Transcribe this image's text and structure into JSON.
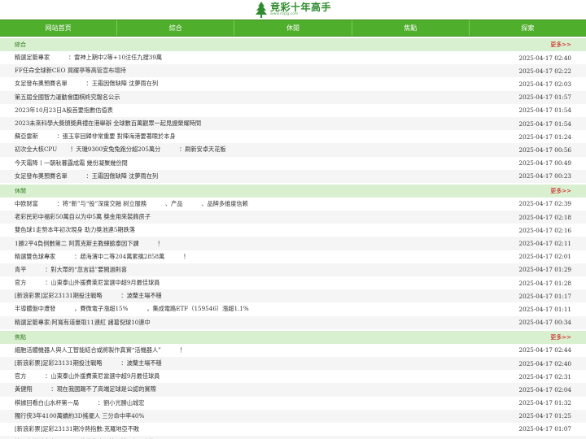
{
  "site": {
    "title": "竞彩十年高手",
    "url": "www.rbjzg.com"
  },
  "nav": [
    "网站首页",
    "綜合",
    "休閒",
    "焦點",
    "探索"
  ],
  "sections": [
    {
      "title": "綜合",
      "more": "更多>>",
      "items": [
        {
          "title": "精選足籃專家          ：雷神上期中2等+10注任九搜39萬",
          "date": "2025-04-17 02:40"
        },
        {
          "title": "FF任命全球新CEO 買躍亭等高管宣布增持",
          "date": "2025-04-17 02:22"
        },
        {
          "title": "女足發布奧預賽名單          ：王霜因傷缺陣 沈夢雨在列",
          "date": "2025-04-17 02:03"
        },
        {
          "title": "第五屆全國智力運動會圍棋終究報名公示",
          "date": "2025-04-17 01:57"
        },
        {
          "title": "2023年10月23日A股首要指數估值表",
          "date": "2025-04-17 01:54"
        },
        {
          "title": "2023未來科學大獎頒獎典禮在港舉辦 全球數百萬觀眾一起見證榮耀時間",
          "date": "2025-04-17 01:54"
        },
        {
          "title": "蘇亞雷斯          ：張玉寧回歸非常重要 對陣海港要著眼於本身",
          "date": "2025-04-17 01:24"
        },
        {
          "title": "初次全大核CPU       ！天璣9300安兔兔跑分超205萬分          ：刷新安卓天花板",
          "date": "2025-04-17 00:56"
        },
        {
          "title": "今天霜降丨一朝秋暮露成霜 幾份凝聚幾份閒",
          "date": "2025-04-17 00:49"
        },
        {
          "title": "女足發布奧預賽名單          ：王霜因傷缺陣 沈夢雨在列",
          "date": "2025-04-17 00:23"
        }
      ]
    },
    {
      "title": "休閒",
      "more": "更多>>",
      "items": [
        {
          "title": "中欧财富          ：将“新”与“投”深度交融 树立服務          、产品          、品牌多维度信赖",
          "date": "2025-04-17 02:39"
        },
        {
          "title": "老彩民彩中福彩50萬自以为中5萬 獎金用來裝飾房子",
          "date": "2025-04-17 02:18"
        },
        {
          "title": "雙色球1走勢本年初次現身 助力獎池連5期跌落",
          "date": "2025-04-17 02:16"
        },
        {
          "title": "1勝2平4負例數第二 阿賈克斯主教練臉泰因下課          ！",
          "date": "2025-04-17 02:11"
        },
        {
          "title": "精選雙色球專家          ：趙海濱中二等204萬累擒2858萬          ！",
          "date": "2025-04-17 02:01"
        },
        {
          "title": "青平          ：對大眾的“忽言話”要閱過則喜",
          "date": "2025-04-17 01:29"
        },
        {
          "title": "官方          ：山東泰山外援費萊尼當選中超9月最佳球員",
          "date": "2025-04-17 01:28"
        },
        {
          "title": "[新浪彩票]足彩23131期投注戰略          ：波蘭主場不穩",
          "date": "2025-04-17 01:17"
        },
        {
          "title": "半導體盤中遭發          ，賽微電子漲超15%          ，集成電路ETF（159546）漲超1.1%",
          "date": "2025-04-17 01:11"
        },
        {
          "title": "精選足籃專家:阿寬有道豪取11連紅 諸葛倪球10連中",
          "date": "2025-04-17 00:34"
        }
      ]
    },
    {
      "title": "焦點",
      "more": "更多>>",
      "items": [
        {
          "title": "細胞活體機器人與人工智能結合或將製作真實“活機器人”          ！",
          "date": "2025-04-17 02:44"
        },
        {
          "title": "[新浪彩票]足彩23131期投注戰略          ：波蘭主場不穩",
          "date": "2025-04-17 02:40"
        },
        {
          "title": "官方          ：山東泰山外援費萊尼當選中超9月最佳球員",
          "date": "2025-04-17 02:31"
        },
        {
          "title": "黃健翔          ：現在我國踢不了高端足球是公認的實際",
          "date": "2025-04-17 02:04"
        },
        {
          "title": "棋據回看白山水杯第一局          ：劉小光勝山城宏",
          "date": "2025-04-17 01:32"
        },
        {
          "title": "獨行侠3年4100萬續約3D搖擺人 三分命中率40%",
          "date": "2025-04-17 01:25"
        },
        {
          "title": "[新浪彩票]足彩23131期冷熱指數:克羅地亞不敗",
          "date": "2025-04-17 01:07"
        },
        {
          "title": "精選大樂透專家          ：徐先生中二等累擒已超2千萬          ！",
          "date": "2025-04-17 00:46"
        }
      ]
    }
  ],
  "colors": {
    "nav_bg": "#4fae2c",
    "section_bg": "#d9f0d0",
    "section_title": "#2e7a1f",
    "more_link": "#cc0000"
  }
}
